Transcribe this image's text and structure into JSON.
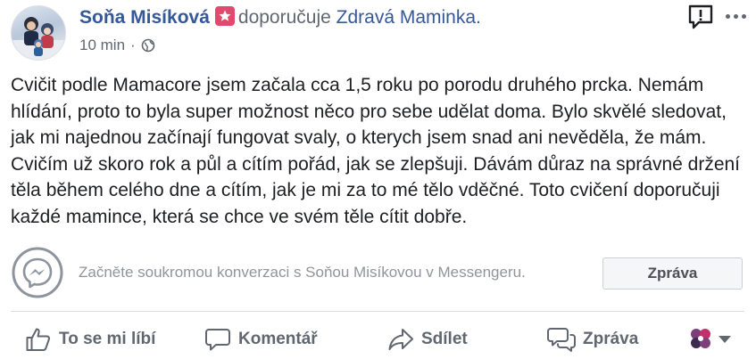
{
  "post": {
    "author": "Soňa Misíková",
    "recommends_text": "doporučuje",
    "page_name": "Zdravá Maminka.",
    "timestamp": "10 min",
    "separator": "·",
    "audience_icon": "globe-icon",
    "text": "Cvičit podle Mamacore jsem začala cca 1,5 roku po porodu druhého prcka. Nemám hlídání, proto to byla super možnost něco pro sebe udělat doma. Bylo skvělé sledovat, jak mi najednou začínají fungovat svaly, o kterych jsem snad ani nevěděla, že mám. Cvičím už skoro rok a půl a cítím pořád, jak se zlepšuji. Dávám důraz na správné držení těla během celého dne a cítím, jak je mi za to mé tělo vděčné. Toto cvičení doporučuji každé mamince, která se chce ve svém těle cítit dobře."
  },
  "messenger": {
    "prompt": "Začněte soukromou konverzaci s Soňou Misíkovou v Messengeru.",
    "button_label": "Zpráva",
    "icon": "messenger-icon"
  },
  "actions": {
    "like": "To se mi líbí",
    "comment": "Komentář",
    "share": "Sdílet",
    "message": "Zpráva"
  },
  "colors": {
    "link": "#365899",
    "secondary": "#606770",
    "badge": "#e14a6e",
    "reaction_purple": "#7b3f7a"
  }
}
